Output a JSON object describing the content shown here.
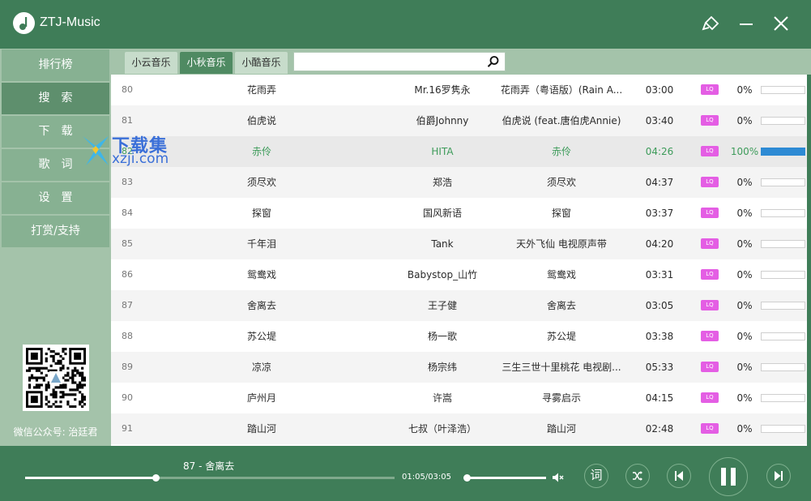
{
  "app": {
    "title": "ZTJ-Music"
  },
  "sidebar": {
    "items": [
      {
        "label": "排行榜",
        "active": false
      },
      {
        "label": "搜　索",
        "active": true
      },
      {
        "label": "下　载",
        "active": false
      },
      {
        "label": "歌　词",
        "active": false
      },
      {
        "label": "设　置",
        "active": false
      },
      {
        "label": "打赏/支持",
        "active": false
      }
    ],
    "wechat_label": "微信公众号: 治廷君"
  },
  "tabs": [
    {
      "label": "小云音乐",
      "active": false
    },
    {
      "label": "小秋音乐",
      "active": true
    },
    {
      "label": "小酷音乐",
      "active": false
    }
  ],
  "search": {
    "value": "",
    "placeholder": ""
  },
  "songs": [
    {
      "idx": "80",
      "title": "花雨弄",
      "artist": "Mr.16罗隽永",
      "album": "花雨弄（粤语版）(Rain A...",
      "duration": "03:00",
      "quality": "LQ",
      "percent": "0%",
      "progress": 0,
      "playing": false
    },
    {
      "idx": "81",
      "title": "伯虎说",
      "artist": "伯爵Johnny",
      "album": "伯虎说 (feat.唐伯虎Annie)",
      "duration": "03:40",
      "quality": "LQ",
      "percent": "0%",
      "progress": 0,
      "playing": false
    },
    {
      "idx": "82",
      "title": "赤伶",
      "artist": "HITA",
      "album": "赤伶",
      "duration": "04:26",
      "quality": "LQ",
      "percent": "100%",
      "progress": 1,
      "playing": true
    },
    {
      "idx": "83",
      "title": "须尽欢",
      "artist": "郑浩",
      "album": "须尽欢",
      "duration": "04:37",
      "quality": "LQ",
      "percent": "0%",
      "progress": 0,
      "playing": false
    },
    {
      "idx": "84",
      "title": "探窗",
      "artist": "国风新语",
      "album": "探窗",
      "duration": "03:37",
      "quality": "LQ",
      "percent": "0%",
      "progress": 0,
      "playing": false
    },
    {
      "idx": "85",
      "title": "千年泪",
      "artist": "Tank",
      "album": "天外飞仙 电视原声带",
      "duration": "04:20",
      "quality": "LQ",
      "percent": "0%",
      "progress": 0,
      "playing": false
    },
    {
      "idx": "86",
      "title": "鸳鸯戏",
      "artist": "Babystop_山竹",
      "album": "鸳鸯戏",
      "duration": "03:31",
      "quality": "LQ",
      "percent": "0%",
      "progress": 0,
      "playing": false
    },
    {
      "idx": "87",
      "title": "舍离去",
      "artist": "王子健",
      "album": "舍离去",
      "duration": "03:05",
      "quality": "LQ",
      "percent": "0%",
      "progress": 0,
      "playing": false
    },
    {
      "idx": "88",
      "title": "苏公堤",
      "artist": "杨一歌",
      "album": "苏公堤",
      "duration": "03:38",
      "quality": "LQ",
      "percent": "0%",
      "progress": 0,
      "playing": false
    },
    {
      "idx": "89",
      "title": "凉凉",
      "artist": "杨宗纬",
      "album": "三生三世十里桃花 电视剧...",
      "duration": "05:33",
      "quality": "LQ",
      "percent": "0%",
      "progress": 0,
      "playing": false
    },
    {
      "idx": "90",
      "title": "庐州月",
      "artist": "许嵩",
      "album": "寻雾启示",
      "duration": "04:15",
      "quality": "LQ",
      "percent": "0%",
      "progress": 0,
      "playing": false
    },
    {
      "idx": "91",
      "title": "踏山河",
      "artist": "七叔（叶泽浩）",
      "album": "踏山河",
      "duration": "02:48",
      "quality": "LQ",
      "percent": "0%",
      "progress": 0,
      "playing": false
    }
  ],
  "watermark": {
    "title": "下载集",
    "subtitle": "xzji.com"
  },
  "player": {
    "now_playing": "87 - 舍离去",
    "time": "01:05/03:05",
    "progress": 0.354,
    "volume": 0,
    "lyric_button": "词"
  },
  "colors": {
    "accent": "#3f7d58",
    "sidebar": "#a4c3aa",
    "playing_text": "#3d9b5a",
    "progress_bar": "#2d8ad4",
    "quality_badge": "#e45ee4"
  },
  "icons": [
    "music-note-icon",
    "skin-icon",
    "minimize-icon",
    "close-icon",
    "search-icon",
    "volume-mute-icon",
    "shuffle-icon",
    "previous-icon",
    "pause-icon",
    "next-icon"
  ]
}
